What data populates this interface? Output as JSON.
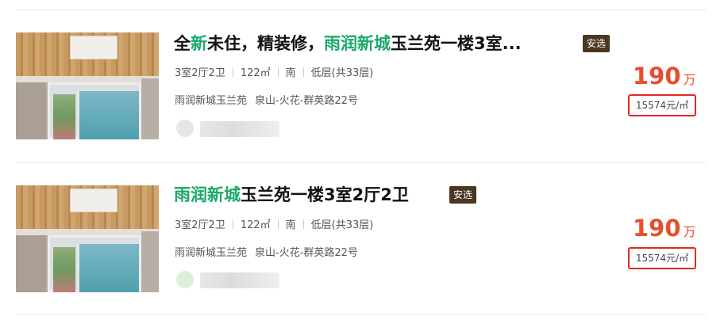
{
  "listings": [
    {
      "title_parts": [
        "全",
        "新",
        "未住，精装修，",
        "雨润新城",
        "玉兰苑一楼3室..."
      ],
      "badge": "安选",
      "layout": "3室2厅2卫",
      "area": "122㎡",
      "orientation": "南",
      "floor": "低层(共33层)",
      "community": "雨润新城玉兰苑",
      "address": "泉山-火花-群英路22号",
      "price": "190",
      "price_unit": "万",
      "unit_price": "15574元/㎡"
    },
    {
      "title_parts": [
        "雨润新城",
        "玉兰苑一楼3室2厅2卫"
      ],
      "badge": "安选",
      "layout": "3室2厅2卫",
      "area": "122㎡",
      "orientation": "南",
      "floor": "低层(共33层)",
      "community": "雨润新城玉兰苑",
      "address": "泉山-火花-群英路22号",
      "price": "190",
      "price_unit": "万",
      "unit_price": "15574元/㎡"
    }
  ],
  "colors": {
    "highlight": "#1ba96a",
    "price": "#e4502f",
    "badge_bg": "#4b3622",
    "annotation_box": "#e32a22"
  }
}
